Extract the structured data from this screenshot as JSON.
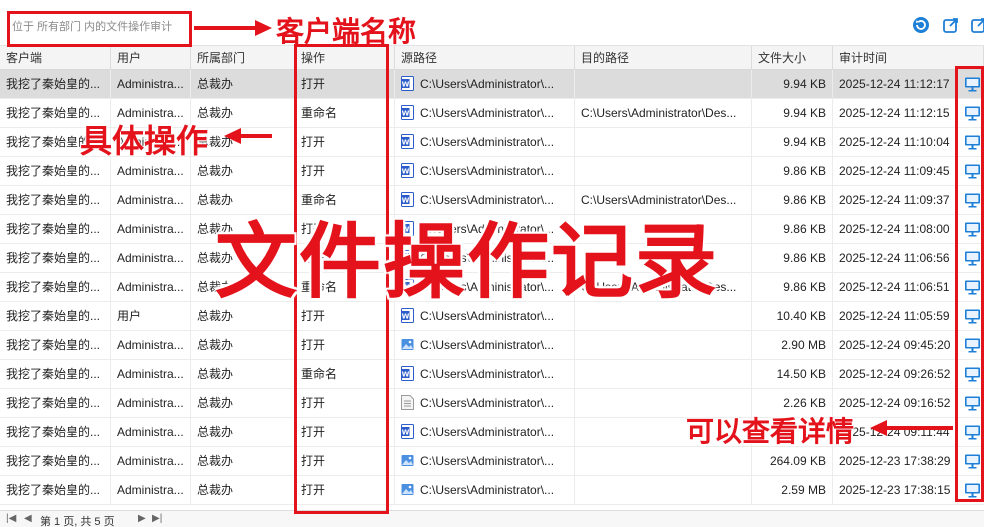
{
  "toolbar": {
    "scope_text": "位于 所有部门 内的文件操作审计",
    "icons": [
      "refresh-icon",
      "export-icon",
      "share-icon"
    ]
  },
  "columns": [
    "客户端",
    "用户",
    "所属部门",
    "操作",
    "源路径",
    "目的路径",
    "文件大小",
    "审计时间"
  ],
  "rows": [
    {
      "client": "我挖了秦始皇的...",
      "user": "Administra...",
      "dept": "总裁办",
      "op": "打开",
      "src": "C:\\Users\\Administrator\\...",
      "dst": "",
      "size": "9.94 KB",
      "time": "2025-12-24 11:12:17",
      "icon": "word"
    },
    {
      "client": "我挖了秦始皇的...",
      "user": "Administra...",
      "dept": "总裁办",
      "op": "重命名",
      "src": "C:\\Users\\Administrator\\...",
      "dst": "C:\\Users\\Administrator\\Des...",
      "size": "9.94 KB",
      "time": "2025-12-24 11:12:15",
      "icon": "word"
    },
    {
      "client": "我挖了秦始皇的...",
      "user": "Administra...",
      "dept": "总裁办",
      "op": "打开",
      "src": "C:\\Users\\Administrator\\...",
      "dst": "",
      "size": "9.94 KB",
      "time": "2025-12-24 11:10:04",
      "icon": "word"
    },
    {
      "client": "我挖了秦始皇的...",
      "user": "Administra...",
      "dept": "总裁办",
      "op": "打开",
      "src": "C:\\Users\\Administrator\\...",
      "dst": "",
      "size": "9.86 KB",
      "time": "2025-12-24 11:09:45",
      "icon": "word"
    },
    {
      "client": "我挖了秦始皇的...",
      "user": "Administra...",
      "dept": "总裁办",
      "op": "重命名",
      "src": "C:\\Users\\Administrator\\...",
      "dst": "C:\\Users\\Administrator\\Des...",
      "size": "9.86 KB",
      "time": "2025-12-24 11:09:37",
      "icon": "word"
    },
    {
      "client": "我挖了秦始皇的...",
      "user": "Administra...",
      "dept": "总裁办",
      "op": "打开",
      "src": "C:\\Users\\Administrator\\...",
      "dst": "",
      "size": "9.86 KB",
      "time": "2025-12-24 11:08:00",
      "icon": "word"
    },
    {
      "client": "我挖了秦始皇的...",
      "user": "Administra...",
      "dept": "总裁办",
      "op": "打开",
      "src": "C:\\Users\\Administrator\\...",
      "dst": "",
      "size": "9.86 KB",
      "time": "2025-12-24 11:06:56",
      "icon": "word"
    },
    {
      "client": "我挖了秦始皇的...",
      "user": "Administra...",
      "dept": "总裁办",
      "op": "重命名",
      "src": "C:\\Users\\Administrator\\...",
      "dst": "C:\\Users\\Administrator\\Des...",
      "size": "9.86 KB",
      "time": "2025-12-24 11:06:51",
      "icon": "word"
    },
    {
      "client": "我挖了秦始皇的...",
      "user": "用户",
      "dept": "总裁办",
      "op": "打开",
      "src": "C:\\Users\\Administrator\\...",
      "dst": "",
      "size": "10.40 KB",
      "time": "2025-12-24 11:05:59",
      "icon": "word"
    },
    {
      "client": "我挖了秦始皇的...",
      "user": "Administra...",
      "dept": "总裁办",
      "op": "打开",
      "src": "C:\\Users\\Administrator\\...",
      "dst": "",
      "size": "2.90 MB",
      "time": "2025-12-24 09:45:20",
      "icon": "image"
    },
    {
      "client": "我挖了秦始皇的...",
      "user": "Administra...",
      "dept": "总裁办",
      "op": "重命名",
      "src": "C:\\Users\\Administrator\\...",
      "dst": "",
      "size": "14.50 KB",
      "time": "2025-12-24 09:26:52",
      "icon": "word"
    },
    {
      "client": "我挖了秦始皇的...",
      "user": "Administra...",
      "dept": "总裁办",
      "op": "打开",
      "src": "C:\\Users\\Administrator\\...",
      "dst": "",
      "size": "2.26 KB",
      "time": "2025-12-24 09:16:52",
      "icon": "text"
    },
    {
      "client": "我挖了秦始皇的...",
      "user": "Administra...",
      "dept": "总裁办",
      "op": "打开",
      "src": "C:\\Users\\Administrator\\...",
      "dst": "",
      "size": "",
      "time": "2025-12-24 09:11:44",
      "icon": "word"
    },
    {
      "client": "我挖了秦始皇的...",
      "user": "Administra...",
      "dept": "总裁办",
      "op": "打开",
      "src": "C:\\Users\\Administrator\\...",
      "dst": "",
      "size": "264.09 KB",
      "time": "2025-12-23 17:38:29",
      "icon": "image"
    },
    {
      "client": "我挖了秦始皇的...",
      "user": "Administra...",
      "dept": "总裁办",
      "op": "打开",
      "src": "C:\\Users\\Administrator\\...",
      "dst": "",
      "size": "2.59 MB",
      "time": "2025-12-23 17:38:15",
      "icon": "image"
    }
  ],
  "pager": {
    "text": "第 1 页, 共 5 页"
  },
  "annotations": {
    "client_name": "客户端名称",
    "specific_op": "具体操作",
    "title": "文件操作记录",
    "view_details": "可以查看详情"
  },
  "colors": {
    "accent_red": "#e3121b",
    "icon_blue": "#1e7fd6",
    "word_blue": "#2b5cc9"
  }
}
